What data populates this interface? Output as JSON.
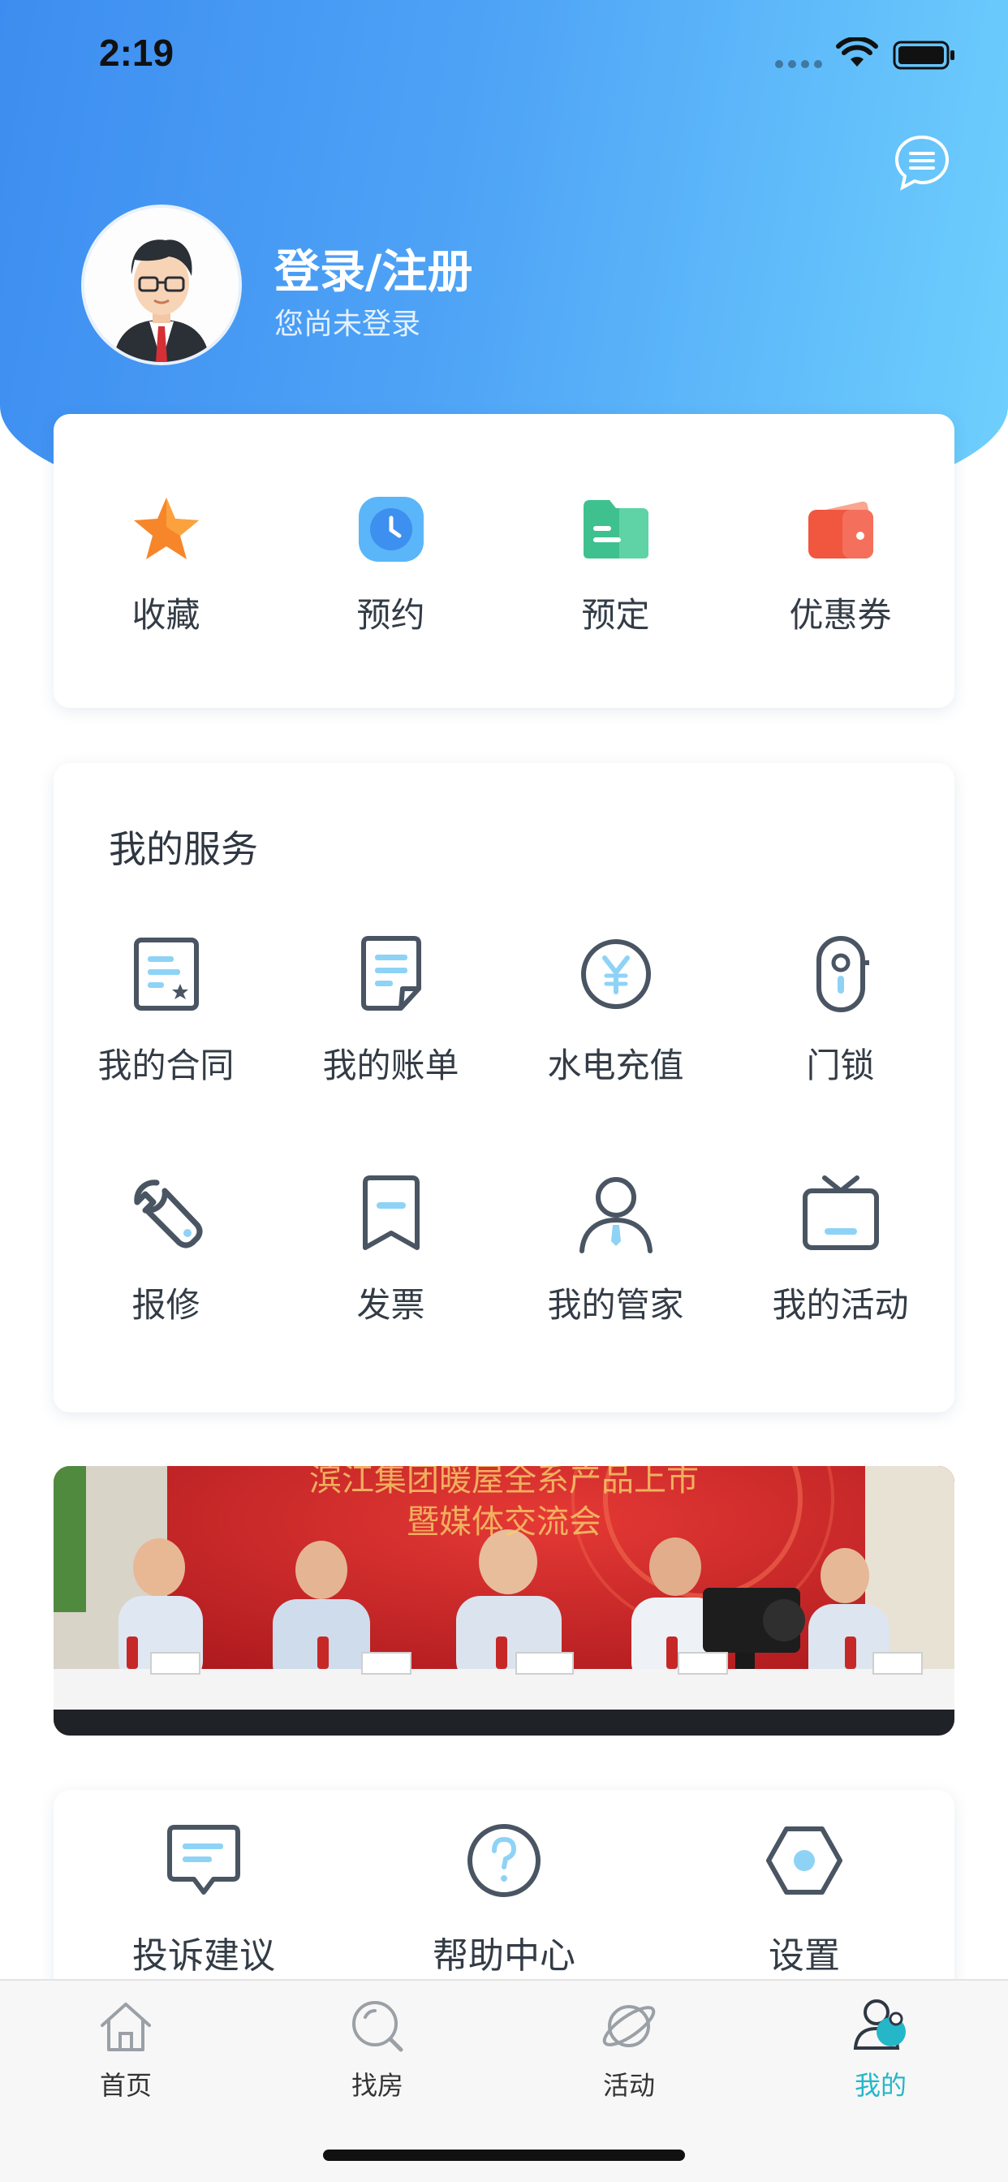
{
  "status_bar": {
    "time": "2:19"
  },
  "header": {
    "login_title": "登录/注册",
    "login_subtitle": "您尚未登录",
    "message_icon": "chat-bubble-icon"
  },
  "quick_actions": [
    {
      "label": "收藏",
      "icon": "star-icon",
      "color": "#f7862a"
    },
    {
      "label": "预约",
      "icon": "clock-icon",
      "color": "#4da6f5"
    },
    {
      "label": "预定",
      "icon": "folder-icon",
      "color": "#3ec18f"
    },
    {
      "label": "优惠券",
      "icon": "wallet-icon",
      "color": "#f1563f"
    }
  ],
  "services": {
    "title": "我的服务",
    "items": [
      {
        "label": "我的合同",
        "icon": "contract-icon"
      },
      {
        "label": "我的账单",
        "icon": "bill-icon"
      },
      {
        "label": "水电充值",
        "icon": "yen-coin-icon"
      },
      {
        "label": "门锁",
        "icon": "door-lock-icon"
      },
      {
        "label": "报修",
        "icon": "wrench-icon"
      },
      {
        "label": "发票",
        "icon": "invoice-icon"
      },
      {
        "label": "我的管家",
        "icon": "butler-icon"
      },
      {
        "label": "我的活动",
        "icon": "tv-activity-icon"
      }
    ]
  },
  "banner": {
    "line1": "滨江集团暖屋全系产品上市",
    "line2": "暨媒体交流会"
  },
  "misc": [
    {
      "label": "投诉建议",
      "icon": "feedback-icon"
    },
    {
      "label": "帮助中心",
      "icon": "help-icon"
    },
    {
      "label": "设置",
      "icon": "settings-hexagon-icon"
    }
  ],
  "tabbar": {
    "active_color": "#25b7c8",
    "tabs": [
      {
        "label": "首页",
        "icon": "home-icon"
      },
      {
        "label": "找房",
        "icon": "search-icon"
      },
      {
        "label": "活动",
        "icon": "planet-icon"
      },
      {
        "label": "我的",
        "icon": "profile-icon",
        "active": true
      }
    ]
  }
}
